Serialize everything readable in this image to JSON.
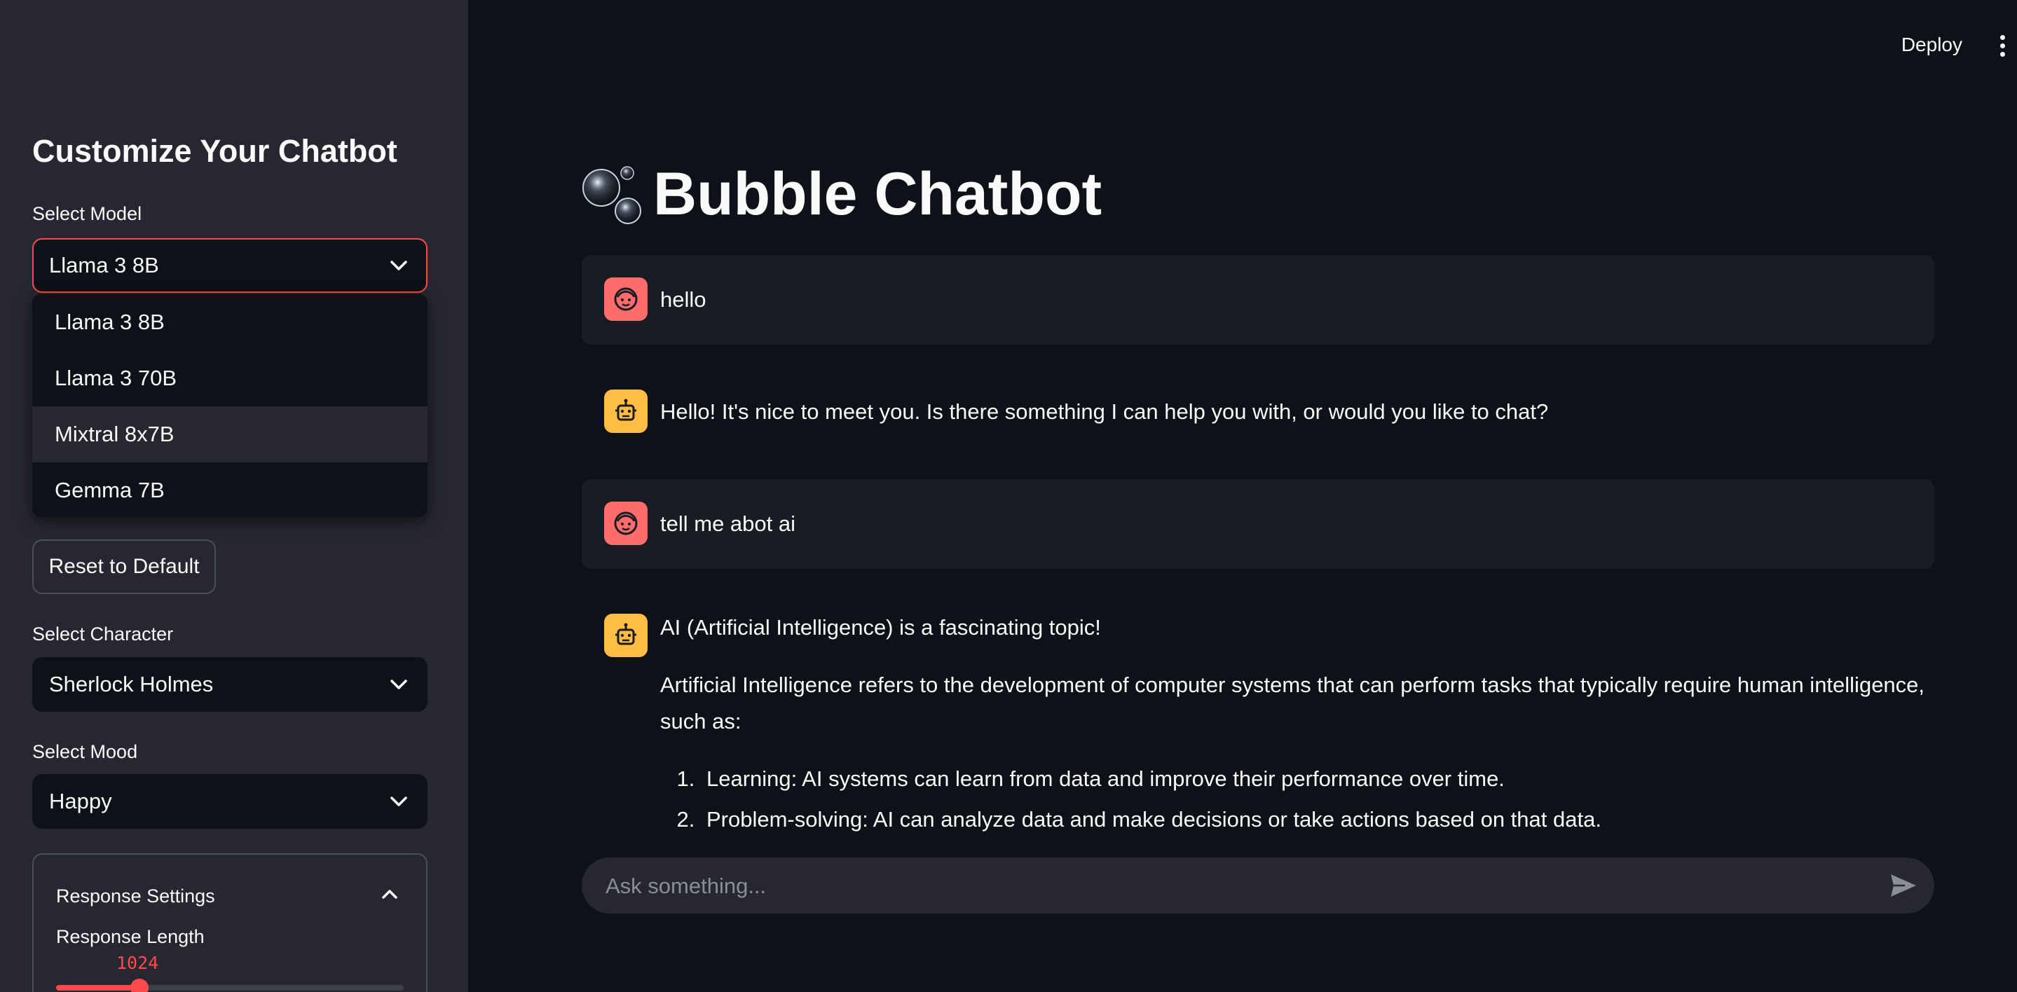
{
  "topbar": {
    "deploy_label": "Deploy"
  },
  "sidebar": {
    "title": "Customize Your Chatbot",
    "model": {
      "label": "Select Model",
      "selected": "Llama 3 8B",
      "options": [
        "Llama 3 8B",
        "Llama 3 70B",
        "Mixtral 8x7B",
        "Gemma 7B"
      ],
      "hovered_option": "Mixtral 8x7B"
    },
    "reset_label": "Reset to Default",
    "character": {
      "label": "Select Character",
      "selected": "Sherlock Holmes"
    },
    "mood": {
      "label": "Select Mood",
      "selected": "Happy"
    },
    "response_settings": {
      "title": "Response Settings",
      "length_label": "Response Length",
      "length_value": "1024",
      "length_fraction": 0.24
    }
  },
  "main": {
    "title": "Bubble Chatbot",
    "messages": [
      {
        "role": "user",
        "text": "hello"
      },
      {
        "role": "assistant",
        "text": "Hello! It's nice to meet you. Is there something I can help you with, or would you like to chat?"
      },
      {
        "role": "user",
        "text": "tell me abot ai"
      },
      {
        "role": "assistant",
        "intro": "AI (Artificial Intelligence) is a fascinating topic!",
        "paragraph": "Artificial Intelligence refers to the development of computer systems that can perform tasks that typically require human intelligence, such as:",
        "list": [
          "Learning: AI systems can learn from data and improve their performance over time.",
          "Problem-solving: AI can analyze data and make decisions or take actions based on that data."
        ]
      }
    ],
    "chat_input": {
      "placeholder": "Ask something..."
    }
  },
  "colors": {
    "background": "#0e1117",
    "sidebar": "#262730",
    "accent": "#ff4b4b",
    "user_avatar": "#ff6c6c",
    "bot_avatar": "#ffbd45"
  },
  "icons": [
    "chevron-down-icon",
    "chevron-up-icon",
    "user-face-icon",
    "robot-icon",
    "send-icon",
    "bubbles-icon",
    "more-vert-icon"
  ]
}
